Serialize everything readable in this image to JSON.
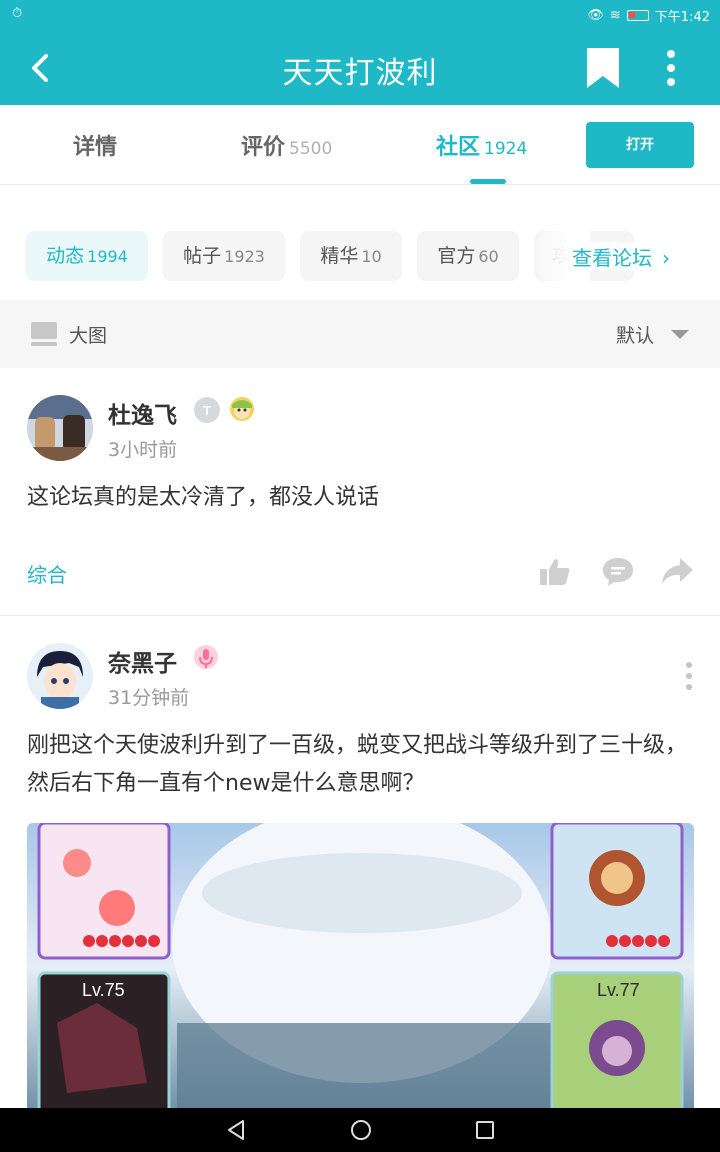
{
  "status_bar": {
    "time": "下午1:42"
  },
  "app_bar": {
    "title": "天天打波利"
  },
  "tabs": [
    {
      "label": "详情",
      "count": ""
    },
    {
      "label": "评价",
      "count": "5500"
    },
    {
      "label": "社区",
      "count": "1924"
    }
  ],
  "open_button": "打开",
  "chips": [
    {
      "label": "动态",
      "count": "1994"
    },
    {
      "label": "帖子",
      "count": "1923"
    },
    {
      "label": "精华",
      "count": "10"
    },
    {
      "label": "官方",
      "count": "60"
    },
    {
      "label": "攻",
      "count": ""
    }
  ],
  "view_forum": "查看论坛",
  "sort_bar": {
    "layout_label": "大图",
    "sort_label": "默认"
  },
  "posts": [
    {
      "username": "杜逸飞",
      "time": "3小时前",
      "text": "这论坛真的是太冷清了，都没人说话",
      "category": "综合"
    },
    {
      "username": "奈黑子",
      "time": "31分钟前",
      "text": "刚把这个天使波利升到了一百级，蜕变又把战斗等级升到了三十级，然后右下角一直有个new是什么意思啊？",
      "image_labels": [
        "Lv.75",
        "Lv.77"
      ]
    }
  ],
  "colors": {
    "accent": "#1fb8c6",
    "status": "#1fb8c6"
  }
}
